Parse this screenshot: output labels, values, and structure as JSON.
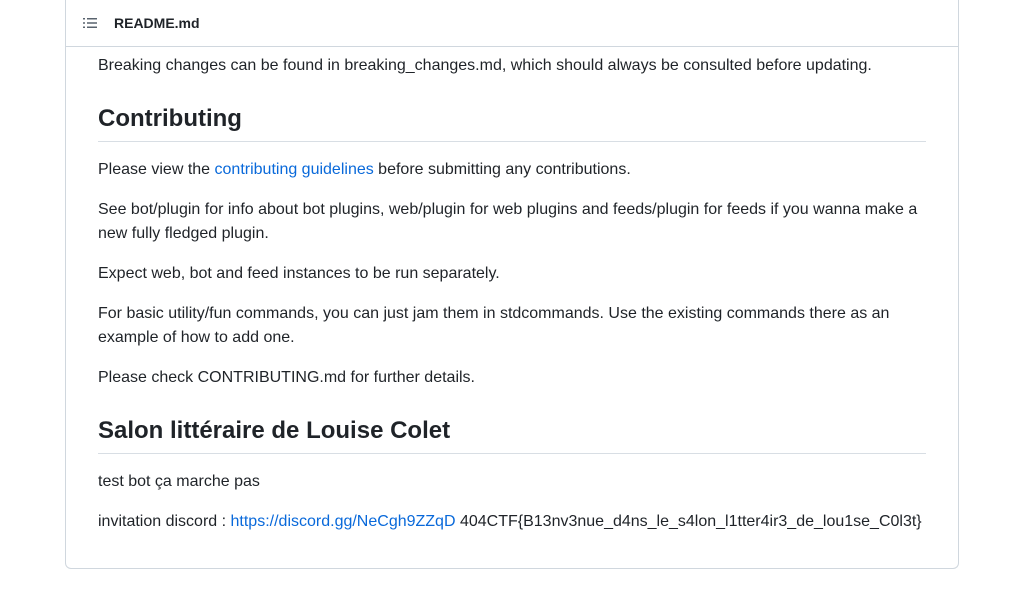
{
  "header": {
    "icon": "list-unordered-icon",
    "title": "README.md"
  },
  "content": {
    "breaking_changes": "Breaking changes can be found in breaking_changes.md, which should always be consulted before updating.",
    "contributing": {
      "heading": "Contributing",
      "p1_before": "Please view the ",
      "p1_link": "contributing guidelines",
      "p1_after": " before submitting any contributions.",
      "p2": "See bot/plugin for info about bot plugins, web/plugin for web plugins and feeds/plugin for feeds if you wanna make a new fully fledged plugin.",
      "p3": "Expect web, bot and feed instances to be run separately.",
      "p4": "For basic utility/fun commands, you can just jam them in stdcommands. Use the existing commands there as an example of how to add one.",
      "p5": "Please check CONTRIBUTING.md for further details."
    },
    "salon": {
      "heading": "Salon littéraire de Louise Colet",
      "p1": "test bot ça marche pas",
      "p2_before": "invitation discord : ",
      "p2_link": "https://discord.gg/NeCgh9ZZqD",
      "p2_after": " 404CTF{B13nv3nue_d4ns_le_s4lon_l1tter4ir3_de_lou1se_C0l3t}"
    }
  },
  "colors": {
    "link": "#0969da",
    "text": "#1f2328",
    "border": "#d0d7de"
  }
}
